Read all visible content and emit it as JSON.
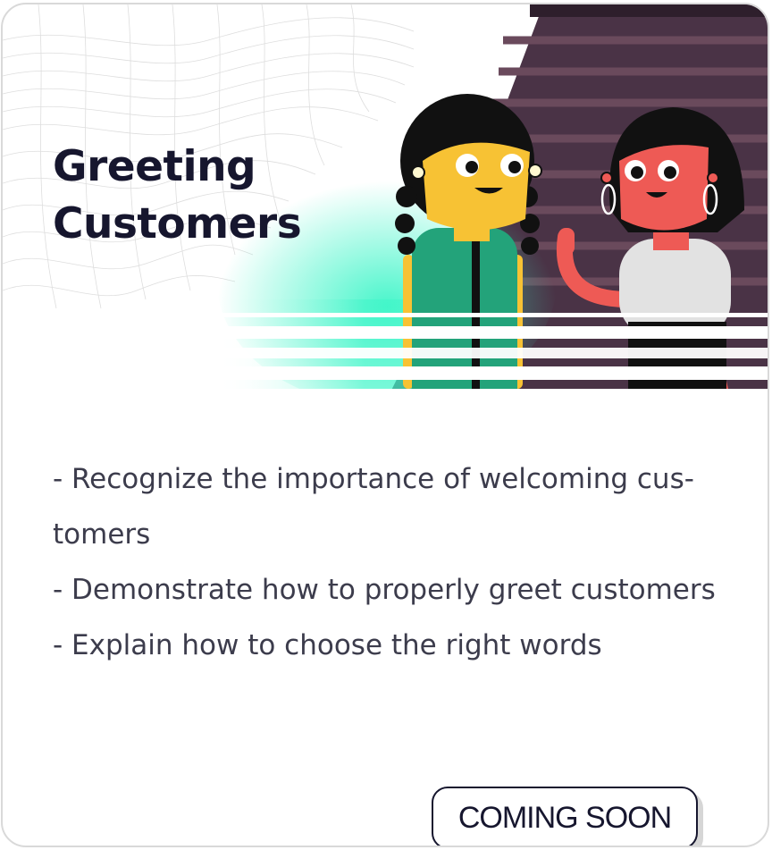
{
  "course": {
    "title_line1": "Greeting",
    "title_line2": "Customers",
    "objectives": [
      "- Recognize the importance of welcoming cus-",
      "tomers",
      "- Demonstrate how to properly greet customers",
      "- Explain how to choose the right words"
    ],
    "status_button": "COMING SOON"
  },
  "colors": {
    "title": "#16162e",
    "body_text": "#3c3c4c",
    "accent_glow": "#3ef5c8",
    "backdrop": "#4a3346",
    "character_left_skin": "#f7c234",
    "character_left_top": "#23a37a",
    "character_right_skin": "#ee5a55",
    "character_right_top": "#e2e2e2"
  },
  "hero_image": {
    "icons": [
      "wireframe-pattern-icon",
      "woman-left-illustration",
      "woman-right-waving-illustration"
    ]
  }
}
